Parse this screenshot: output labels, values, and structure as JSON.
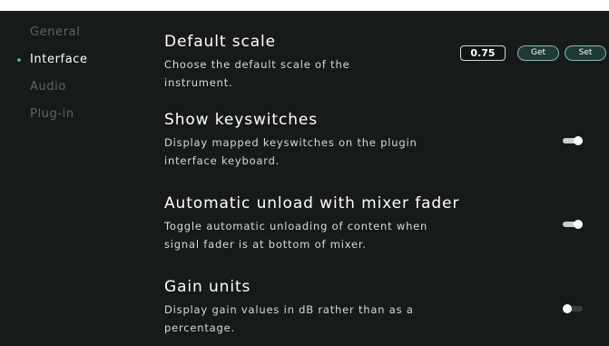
{
  "sidebar": {
    "items": [
      {
        "label": "General",
        "active": false
      },
      {
        "label": "Interface",
        "active": true
      },
      {
        "label": "Audio",
        "active": false
      },
      {
        "label": "Plug-in",
        "active": false
      }
    ]
  },
  "settings": {
    "default_scale": {
      "title": "Default scale",
      "description": "Choose the default scale of the instrument.",
      "value": "0.75",
      "get_label": "Get",
      "set_label": "Set"
    },
    "show_keyswitches": {
      "title": "Show keyswitches",
      "description": "Display mapped keyswitches on the plugin interface keyboard.",
      "enabled": true
    },
    "auto_unload": {
      "title": "Automatic unload with mixer fader",
      "description": "Toggle automatic unloading of content when signal fader is at bottom of mixer.",
      "enabled": true
    },
    "gain_units": {
      "title": "Gain units",
      "description": "Display gain values in dB rather than as a percentage.",
      "enabled": false
    }
  },
  "colors": {
    "panel_background": "#161a18",
    "accent": "#4fa8a6",
    "button_fill": "#1f3a35",
    "text_primary": "#ffffff",
    "text_muted": "#5f6662"
  }
}
